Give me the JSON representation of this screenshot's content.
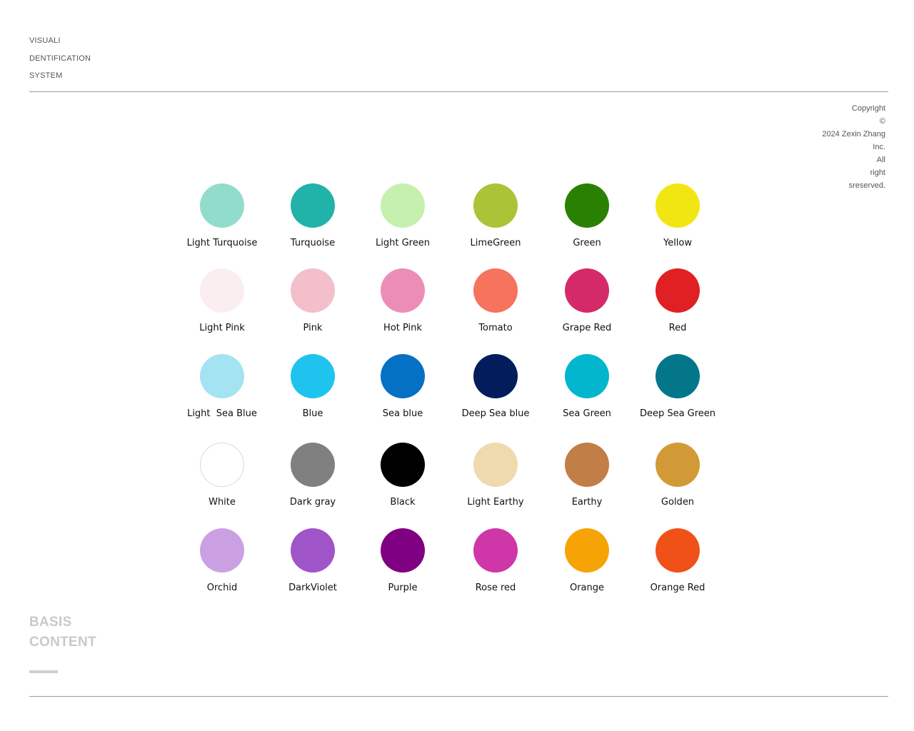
{
  "header": {
    "lines": [
      "VISUALI",
      "DENTIFICATION",
      "SYSTEM"
    ]
  },
  "copyright": {
    "lines": [
      "Copyright",
      "©",
      "2024  Zexin Zhang",
      "Inc.",
      "All",
      "right",
      "sreserved."
    ]
  },
  "palette": [
    {
      "name": "Light Turquoise",
      "color": "#92dccd"
    },
    {
      "name": "Turquoise",
      "color": "#21b2aa"
    },
    {
      "name": "Light Green",
      "color": "#c6f0ae"
    },
    {
      "name": "LimeGreen",
      "color": "#aac437"
    },
    {
      "name": "Green",
      "color": "#2a8003"
    },
    {
      "name": "Yellow",
      "color": "#f2e612"
    },
    {
      "name": "Light Pink",
      "color": "#faeef0"
    },
    {
      "name": "Pink",
      "color": "#f3bfcb"
    },
    {
      "name": "Hot Pink",
      "color": "#ec8db8"
    },
    {
      "name": "Tomato",
      "color": "#f6735e"
    },
    {
      "name": "Grape Red",
      "color": "#d42a69"
    },
    {
      "name": "Red",
      "color": "#e02023"
    },
    {
      "name": "Light  Sea Blue",
      "color": "#a4e3f2"
    },
    {
      "name": "Blue",
      "color": "#1ec4ee"
    },
    {
      "name": "Sea blue",
      "color": "#0471c4"
    },
    {
      "name": "Deep Sea blue",
      "color": "#031c5c"
    },
    {
      "name": "Sea Green",
      "color": "#02b6cd"
    },
    {
      "name": "Deep Sea Green",
      "color": "#037789"
    },
    {
      "name": "White",
      "color": "#ffffff"
    },
    {
      "name": "Dark gray",
      "color": "#808080"
    },
    {
      "name": "Black",
      "color": "#000000"
    },
    {
      "name": "Light Earthy",
      "color": "#efdaae"
    },
    {
      "name": "Earthy",
      "color": "#c17e47"
    },
    {
      "name": "Golden",
      "color": "#d29a36"
    },
    {
      "name": "Orchid",
      "color": "#cba0e3"
    },
    {
      "name": "DarkViolet",
      "color": "#9f54c8"
    },
    {
      "name": "Purple",
      "color": "#800082"
    },
    {
      "name": "Rose red",
      "color": "#cf36a8"
    },
    {
      "name": "Orange",
      "color": "#f6a405"
    },
    {
      "name": "Orange Red",
      "color": "#f05119"
    }
  ],
  "footer": {
    "lines": [
      "BASIS",
      "CONTENT"
    ]
  }
}
